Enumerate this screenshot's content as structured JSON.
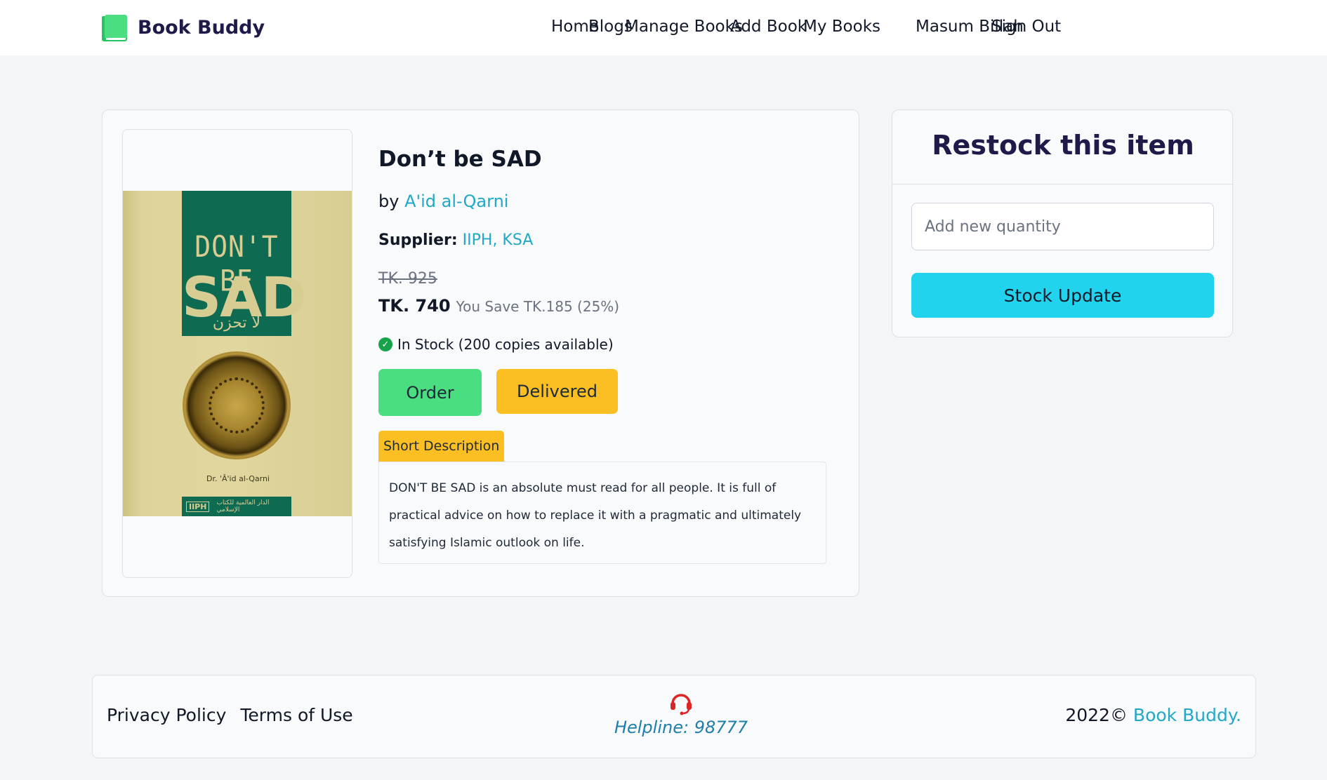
{
  "header": {
    "brand": "Book Buddy",
    "nav": [
      "Home",
      "Blogs",
      "Manage Books",
      "Add Book",
      "My Books",
      "Masum Billah",
      "Sign Out"
    ]
  },
  "product": {
    "title": "Don’t be SAD",
    "by_prefix": "by ",
    "author": "A'id al-Qarni",
    "supplier_label": "Supplier:",
    "supplier": "IIPH, KSA",
    "old_price": "TK. 925",
    "price": "TK. 740",
    "save_text": "You Save TK.185 (25%)",
    "stock_text": "In Stock (200 copies available)",
    "order_label": "Order",
    "delivered_label": "Delivered",
    "desc_tab": "Short Description",
    "description": "DON'T BE SAD is an absolute must read for all people. It is full of practical advice on how to replace it with a pragmatic and ultimately satisfying Islamic outlook on life.",
    "cover": {
      "line1": "DON'T BE",
      "line2": "SAD",
      "arabic": "لا تحزن",
      "author": "Dr. 'Â'id al-Qarni",
      "publisher": "IIPH",
      "publisher_arabic": "الدار العالمية للكتاب الإسلامي"
    }
  },
  "restock": {
    "title": "Restock this item",
    "input_placeholder": "Add new quantity",
    "button_label": "Stock Update"
  },
  "footer": {
    "links": [
      "Privacy Policy",
      "Terms of Use"
    ],
    "helpline": "Helpline: 98777",
    "copyright_prefix": "2022©",
    "copyright_brand": "Book Buddy."
  },
  "colors": {
    "accent": "#22a8c7",
    "order": "#4ade80",
    "delivered": "#fbbf24",
    "stock_button": "#22d3ee",
    "brand_dark": "#1e1b4b",
    "in_stock": "#16a34a",
    "helpline_icon": "#dc2626"
  }
}
